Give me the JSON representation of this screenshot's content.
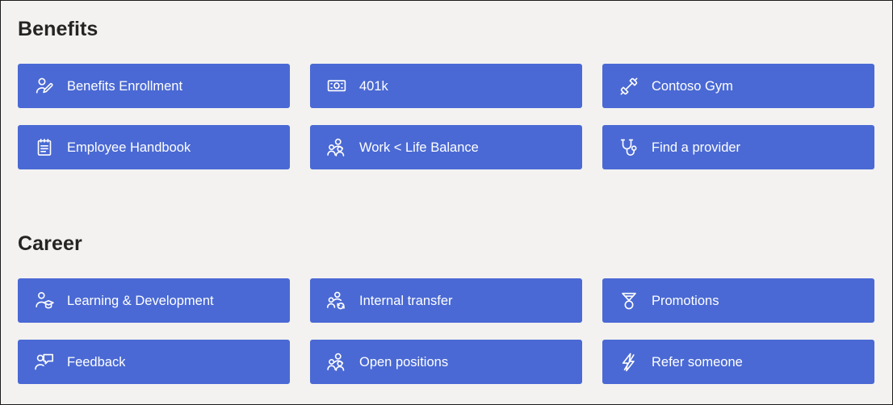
{
  "page": {
    "background_color": "#f3f2f1",
    "accent_color": "#4a69d4",
    "text_color": "#ffffff",
    "heading_color": "#252423"
  },
  "sections": [
    {
      "id": "benefits",
      "title": "Benefits",
      "tiles": [
        {
          "label": "Benefits Enrollment",
          "icon": "person-edit-icon"
        },
        {
          "label": "401k",
          "icon": "money-bill-icon"
        },
        {
          "label": "Contoso Gym",
          "icon": "dumbbell-icon"
        },
        {
          "label": "Employee Handbook",
          "icon": "notebook-icon"
        },
        {
          "label": "Work < Life Balance",
          "icon": "people-group-icon"
        },
        {
          "label": "Find a provider",
          "icon": "stethoscope-icon"
        }
      ]
    },
    {
      "id": "career",
      "title": "Career",
      "tiles": [
        {
          "label": "Learning & Development",
          "icon": "person-graduation-cap-icon"
        },
        {
          "label": "Internal transfer",
          "icon": "people-sync-icon"
        },
        {
          "label": "Promotions",
          "icon": "award-medal-icon"
        },
        {
          "label": "Feedback",
          "icon": "person-feedback-icon"
        },
        {
          "label": "Open positions",
          "icon": "people-group-icon"
        },
        {
          "label": "Refer someone",
          "icon": "lightning-bolt-icon"
        }
      ]
    }
  ]
}
